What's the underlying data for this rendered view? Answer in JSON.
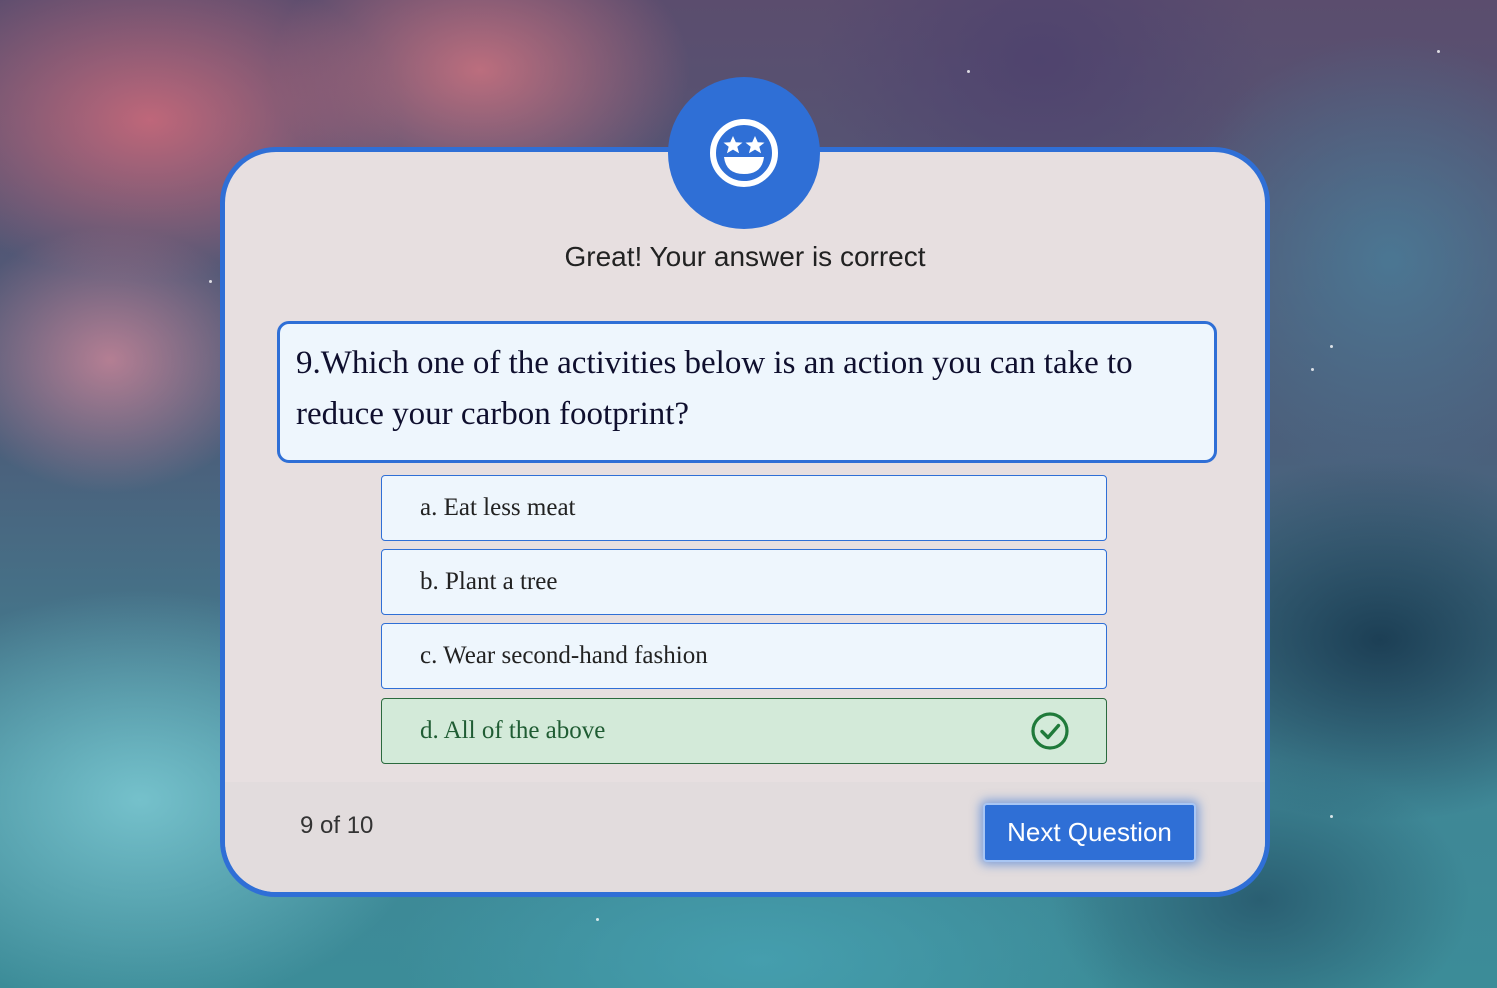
{
  "feedback": {
    "message": "Great! Your answer is correct",
    "icon": "star-struck-face-icon"
  },
  "question": {
    "number": 9,
    "text": "9.Which one of the activities below is an action you can take to reduce your carbon footprint?"
  },
  "options": [
    {
      "label": "a. Eat less meat",
      "state": "default"
    },
    {
      "label": "b. Plant a tree",
      "state": "default"
    },
    {
      "label": "c. Wear second-hand fashion",
      "state": "default"
    },
    {
      "label": "d. All of the above",
      "state": "correct",
      "icon": "check-circle-icon"
    }
  ],
  "footer": {
    "progress": "9 of 10",
    "next_label": "Next Question"
  },
  "colors": {
    "accent": "#2f6fd6",
    "card_bg": "#e7dfe0",
    "question_bg": "#eef6fd",
    "correct_bg": "#d3ead9",
    "correct_text": "#1f5c33"
  }
}
